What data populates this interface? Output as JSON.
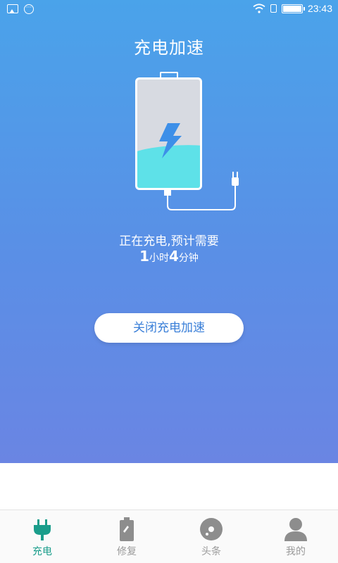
{
  "status_bar": {
    "time": "23:43",
    "left_icons": [
      "image-icon",
      "more-dots-icon"
    ],
    "right_icons": [
      "wifi-icon",
      "sim-icon",
      "battery-full-icon"
    ]
  },
  "header": {
    "title": "充电加速"
  },
  "charging": {
    "status_text": "正在充电,预计需要",
    "hours_value": "1",
    "hours_unit": "小时",
    "minutes_value": "4",
    "minutes_unit": "分钟"
  },
  "actions": {
    "close_boost_label": "关闭充电加速"
  },
  "bottom_nav": {
    "items": [
      {
        "label": "充电",
        "icon": "plug-icon",
        "active": true
      },
      {
        "label": "修复",
        "icon": "battery-wrench-icon",
        "active": false
      },
      {
        "label": "头条",
        "icon": "news-disc-icon",
        "active": false
      },
      {
        "label": "我的",
        "icon": "person-icon",
        "active": false
      }
    ]
  },
  "colors": {
    "gradient_top": "#4aa3ea",
    "gradient_bottom": "#6a85e3",
    "liquid": "#5ee1e8",
    "active_nav": "#1a9d8b",
    "inactive_nav": "#9a9a9a",
    "button_text": "#3a7fd8"
  }
}
